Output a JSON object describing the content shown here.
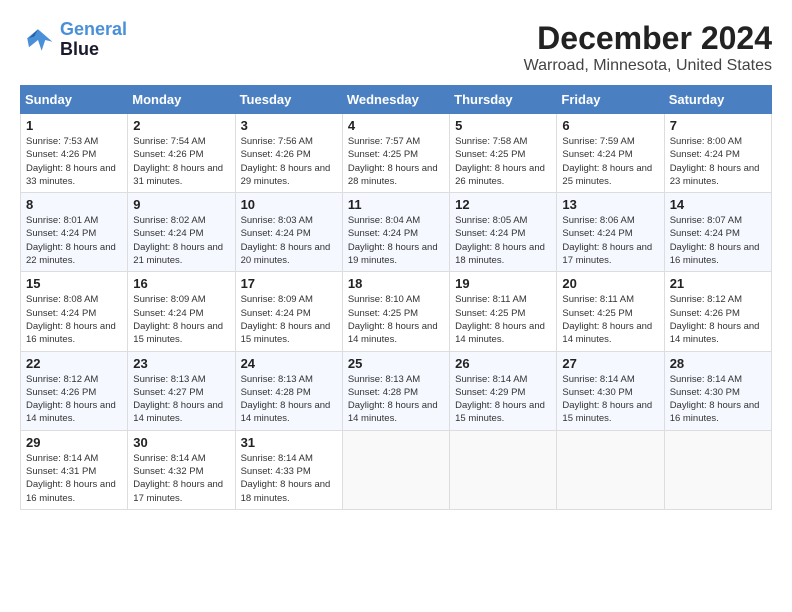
{
  "logo": {
    "line1": "General",
    "line2": "Blue"
  },
  "title": "December 2024",
  "subtitle": "Warroad, Minnesota, United States",
  "weekdays": [
    "Sunday",
    "Monday",
    "Tuesday",
    "Wednesday",
    "Thursday",
    "Friday",
    "Saturday"
  ],
  "weeks": [
    [
      {
        "day": "1",
        "sunrise": "7:53 AM",
        "sunset": "4:26 PM",
        "daylight": "8 hours and 33 minutes."
      },
      {
        "day": "2",
        "sunrise": "7:54 AM",
        "sunset": "4:26 PM",
        "daylight": "8 hours and 31 minutes."
      },
      {
        "day": "3",
        "sunrise": "7:56 AM",
        "sunset": "4:26 PM",
        "daylight": "8 hours and 29 minutes."
      },
      {
        "day": "4",
        "sunrise": "7:57 AM",
        "sunset": "4:25 PM",
        "daylight": "8 hours and 28 minutes."
      },
      {
        "day": "5",
        "sunrise": "7:58 AM",
        "sunset": "4:25 PM",
        "daylight": "8 hours and 26 minutes."
      },
      {
        "day": "6",
        "sunrise": "7:59 AM",
        "sunset": "4:24 PM",
        "daylight": "8 hours and 25 minutes."
      },
      {
        "day": "7",
        "sunrise": "8:00 AM",
        "sunset": "4:24 PM",
        "daylight": "8 hours and 23 minutes."
      }
    ],
    [
      {
        "day": "8",
        "sunrise": "8:01 AM",
        "sunset": "4:24 PM",
        "daylight": "8 hours and 22 minutes."
      },
      {
        "day": "9",
        "sunrise": "8:02 AM",
        "sunset": "4:24 PM",
        "daylight": "8 hours and 21 minutes."
      },
      {
        "day": "10",
        "sunrise": "8:03 AM",
        "sunset": "4:24 PM",
        "daylight": "8 hours and 20 minutes."
      },
      {
        "day": "11",
        "sunrise": "8:04 AM",
        "sunset": "4:24 PM",
        "daylight": "8 hours and 19 minutes."
      },
      {
        "day": "12",
        "sunrise": "8:05 AM",
        "sunset": "4:24 PM",
        "daylight": "8 hours and 18 minutes."
      },
      {
        "day": "13",
        "sunrise": "8:06 AM",
        "sunset": "4:24 PM",
        "daylight": "8 hours and 17 minutes."
      },
      {
        "day": "14",
        "sunrise": "8:07 AM",
        "sunset": "4:24 PM",
        "daylight": "8 hours and 16 minutes."
      }
    ],
    [
      {
        "day": "15",
        "sunrise": "8:08 AM",
        "sunset": "4:24 PM",
        "daylight": "8 hours and 16 minutes."
      },
      {
        "day": "16",
        "sunrise": "8:09 AM",
        "sunset": "4:24 PM",
        "daylight": "8 hours and 15 minutes."
      },
      {
        "day": "17",
        "sunrise": "8:09 AM",
        "sunset": "4:24 PM",
        "daylight": "8 hours and 15 minutes."
      },
      {
        "day": "18",
        "sunrise": "8:10 AM",
        "sunset": "4:25 PM",
        "daylight": "8 hours and 14 minutes."
      },
      {
        "day": "19",
        "sunrise": "8:11 AM",
        "sunset": "4:25 PM",
        "daylight": "8 hours and 14 minutes."
      },
      {
        "day": "20",
        "sunrise": "8:11 AM",
        "sunset": "4:25 PM",
        "daylight": "8 hours and 14 minutes."
      },
      {
        "day": "21",
        "sunrise": "8:12 AM",
        "sunset": "4:26 PM",
        "daylight": "8 hours and 14 minutes."
      }
    ],
    [
      {
        "day": "22",
        "sunrise": "8:12 AM",
        "sunset": "4:26 PM",
        "daylight": "8 hours and 14 minutes."
      },
      {
        "day": "23",
        "sunrise": "8:13 AM",
        "sunset": "4:27 PM",
        "daylight": "8 hours and 14 minutes."
      },
      {
        "day": "24",
        "sunrise": "8:13 AM",
        "sunset": "4:28 PM",
        "daylight": "8 hours and 14 minutes."
      },
      {
        "day": "25",
        "sunrise": "8:13 AM",
        "sunset": "4:28 PM",
        "daylight": "8 hours and 14 minutes."
      },
      {
        "day": "26",
        "sunrise": "8:14 AM",
        "sunset": "4:29 PM",
        "daylight": "8 hours and 15 minutes."
      },
      {
        "day": "27",
        "sunrise": "8:14 AM",
        "sunset": "4:30 PM",
        "daylight": "8 hours and 15 minutes."
      },
      {
        "day": "28",
        "sunrise": "8:14 AM",
        "sunset": "4:30 PM",
        "daylight": "8 hours and 16 minutes."
      }
    ],
    [
      {
        "day": "29",
        "sunrise": "8:14 AM",
        "sunset": "4:31 PM",
        "daylight": "8 hours and 16 minutes."
      },
      {
        "day": "30",
        "sunrise": "8:14 AM",
        "sunset": "4:32 PM",
        "daylight": "8 hours and 17 minutes."
      },
      {
        "day": "31",
        "sunrise": "8:14 AM",
        "sunset": "4:33 PM",
        "daylight": "8 hours and 18 minutes."
      },
      null,
      null,
      null,
      null
    ]
  ]
}
